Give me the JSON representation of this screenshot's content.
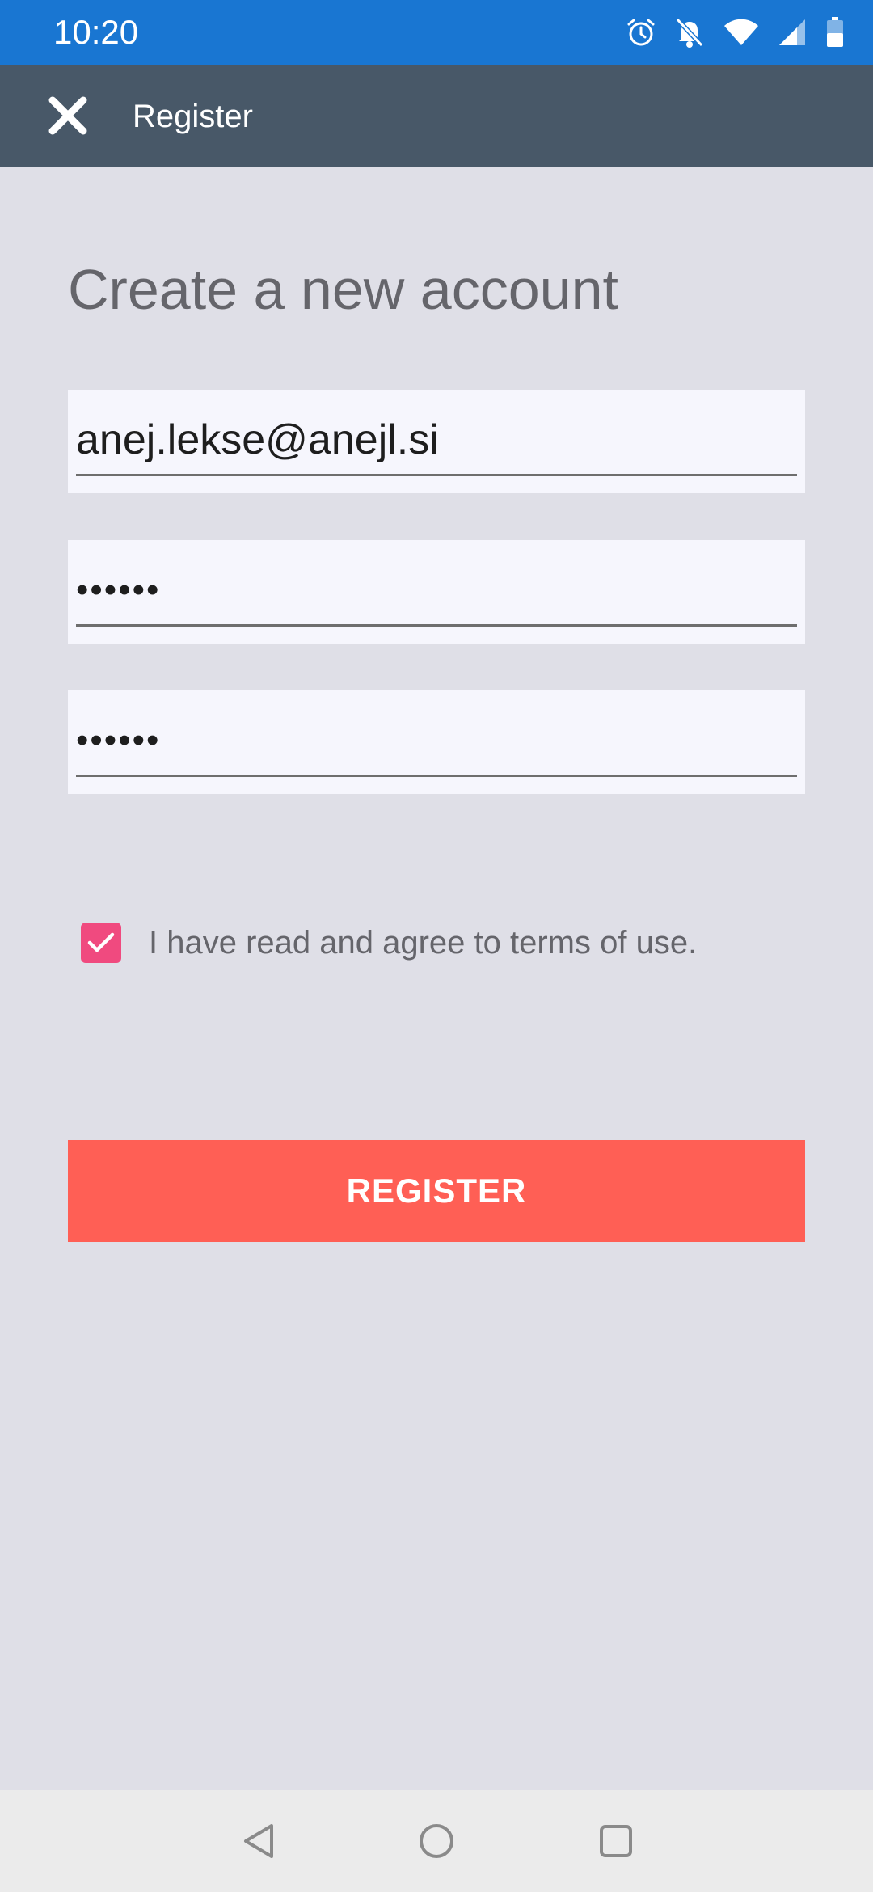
{
  "status_bar": {
    "time": "10:20",
    "icons": [
      "alarm-icon",
      "notifications-off-icon",
      "wifi-icon",
      "signal-icon",
      "battery-icon"
    ]
  },
  "app_bar": {
    "title": "Register",
    "close_icon": "close-icon"
  },
  "form": {
    "heading": "Create a new account",
    "email_value": "anej.lekse@anejl.si",
    "password_value": "••••••",
    "confirm_password_value": "••••••",
    "terms_checked": true,
    "terms_label": "I have read and agree to terms of use.",
    "register_label": "REGISTER"
  },
  "nav_bar": {
    "buttons": [
      "back-icon",
      "home-icon",
      "recents-icon"
    ]
  },
  "colors": {
    "status_bar": "#1976d2",
    "app_bar": "#485868",
    "background": "#dfdfe7",
    "field_background": "#f6f6fd",
    "checkbox": "#f04a7f",
    "register_button": "#ff5f55"
  }
}
